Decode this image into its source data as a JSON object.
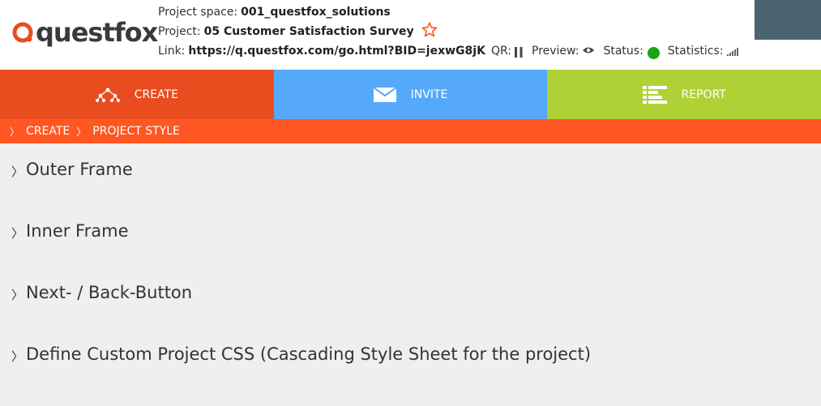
{
  "brand": {
    "logo_text": "questfox"
  },
  "project_info": {
    "space_label": "Project space:",
    "space_value": "001_questfox_solutions",
    "project_label": "Project:",
    "project_value": "05 Customer Satisfaction Survey",
    "link_label": "Link:",
    "link_value": "https://q.questfox.com/go.html?BID=jexwG8jK",
    "qr_label": "QR:",
    "preview_label": "Preview:",
    "status_label": "Status:",
    "statistics_label": "Statistics:",
    "status_color": "#19a317"
  },
  "nav": {
    "create_label": "CREATE",
    "invite_label": "INVITE",
    "report_label": "REPORT",
    "colors": {
      "create": "#e84c1f",
      "invite": "#56a8fb",
      "report": "#afd136"
    }
  },
  "breadcrumb": {
    "items": [
      {
        "label": "CREATE"
      },
      {
        "label": "PROJECT STYLE"
      }
    ],
    "color": "#ff5722"
  },
  "sections": [
    {
      "label": "Outer Frame"
    },
    {
      "label": "Inner Frame"
    },
    {
      "label": "Next- / Back-Button"
    },
    {
      "label": "Define Custom Project CSS (Cascading Style Sheet for the project)"
    }
  ]
}
